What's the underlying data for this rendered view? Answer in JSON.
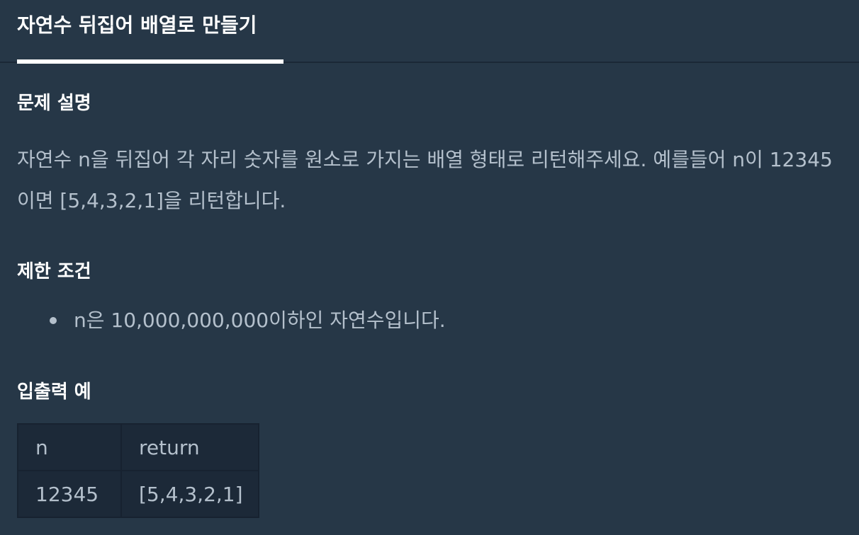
{
  "tab": {
    "title": "자연수 뒤집어 배열로 만들기"
  },
  "sections": {
    "description_heading": "문제 설명",
    "description_text": "자연수 n을 뒤집어 각 자리 숫자를 원소로 가지는 배열 형태로 리턴해주세요. 예를들어 n이 12345이면 [5,4,3,2,1]을 리턴합니다.",
    "constraints_heading": "제한 조건",
    "constraints": [
      "n은 10,000,000,000이하인 자연수입니다."
    ],
    "examples_heading": "입출력 예"
  },
  "examples_table": {
    "headers": [
      "n",
      "return"
    ],
    "rows": [
      [
        "12345",
        "[5,4,3,2,1]"
      ]
    ]
  },
  "colors": {
    "background": "#263747",
    "table_background": "#1c2938",
    "heading": "#ffffff",
    "body_text": "#b4c0cc"
  }
}
